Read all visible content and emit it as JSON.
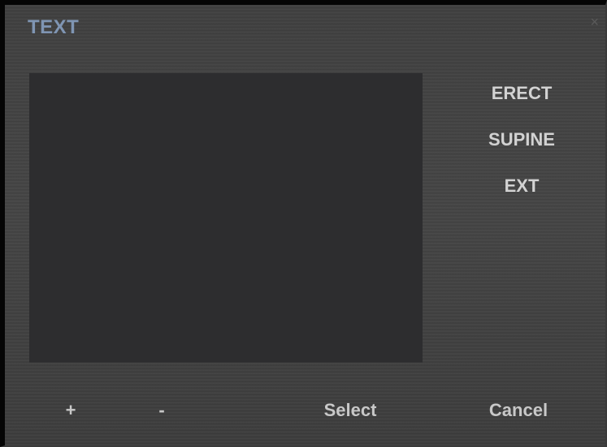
{
  "dialog": {
    "title": "TEXT",
    "close_label": "×"
  },
  "options": [
    {
      "label": "ERECT"
    },
    {
      "label": "SUPINE"
    },
    {
      "label": "EXT"
    }
  ],
  "footer": {
    "add_label": "+",
    "remove_label": "-",
    "select_label": "Select",
    "cancel_label": "Cancel"
  }
}
